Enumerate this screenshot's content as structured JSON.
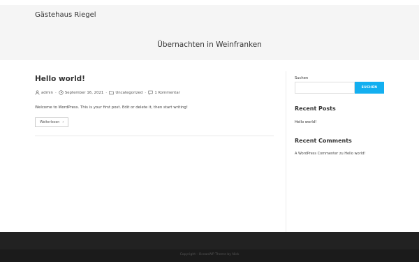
{
  "header": {
    "site_title": "Gästehaus Riegel",
    "page_heading": "Übernachten in Weinfranken"
  },
  "post": {
    "title": "Hello world!",
    "meta": {
      "author": "admin",
      "date": "September 16, 2021",
      "category": "Uncategorized",
      "comments": "1 Kommentar"
    },
    "excerpt": "Welcome to WordPress. This is your first post. Edit or delete it, then start writing!",
    "read_more": "Weiterlesen"
  },
  "sidebar": {
    "search_label": "Suchen",
    "search_value": "",
    "search_button": "SUCHEN",
    "recent_posts_title": "Recent Posts",
    "recent_posts": [
      "Hello world!"
    ],
    "recent_comments_title": "Recent Comments",
    "recent_comment": {
      "author": "A WordPress Commenter",
      "connector": "zu",
      "post": "Hello world!"
    }
  },
  "footer": {
    "copyright": "Copyright - OceanWP Theme by Nick"
  },
  "colors": {
    "accent": "#13aff0",
    "header_bg": "#f5f5f5",
    "footer_bg": "#222222"
  }
}
